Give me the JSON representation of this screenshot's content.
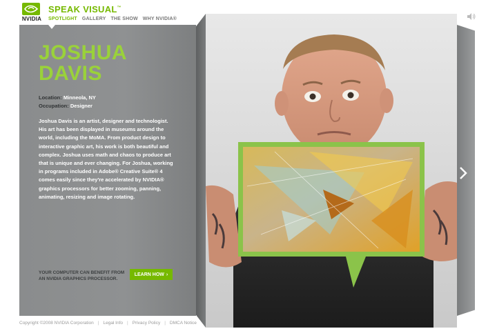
{
  "brand": {
    "logo_text": "NVIDIA",
    "title": "SPEAK VISUAL",
    "title_mark": "™",
    "accent_color": "#76b900"
  },
  "nav": {
    "items": [
      {
        "label": "SPOTLIGHT",
        "active": true
      },
      {
        "label": "GALLERY",
        "active": false
      },
      {
        "label": "THE SHOW",
        "active": false
      },
      {
        "label": "WHY NVIDIA®",
        "active": false
      }
    ]
  },
  "profile": {
    "name_line1": "JOSHUA",
    "name_line2": "DAVIS",
    "location_label": "Location:",
    "location_value": "Minneola, NY",
    "occupation_label": "Occupation:",
    "occupation_value": "Designer",
    "bio": "Joshua Davis is an artist, designer and technologist. His art has been displayed in museums around the world, including the MoMA. From product design to interactive graphic art, his work is both beautiful and complex. Joshua uses math and chaos to produce art that is unique and ever changing. For Joshua, working in programs included in Adobe® Creative Suite® 4 comes easily since they're accelerated by NVIDIA® graphics processors for better zooming, panning, animating, resizing and image rotating."
  },
  "promo": {
    "text": "YOUR COMPUTER CAN BENEFIT FROM AN NVIDIA GRAPHICS PROCESSOR.",
    "button_label": "LEARN HOW",
    "button_arrow": "›"
  },
  "icons": {
    "sound": "speaker-icon",
    "next": "chevron-right-icon"
  },
  "footer": {
    "copyright": "Copyright ©2008 NVIDIA Corporation",
    "links": [
      "Legal Info",
      "Privacy Policy",
      "DMCA Notice"
    ],
    "separator": "|"
  }
}
